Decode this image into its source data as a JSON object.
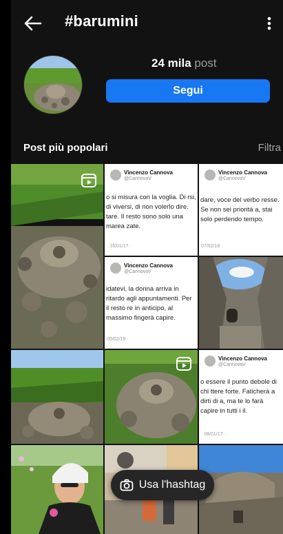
{
  "header": {
    "title": "#barumini"
  },
  "profile": {
    "post_count": "24 mila",
    "post_label": "post",
    "follow_label": "Segui"
  },
  "section": {
    "title": "Post più popolari",
    "filter_label": "Filtra"
  },
  "tweets": [
    {
      "name": "Vincenzo Cannova",
      "handle": "@CannovaV",
      "text": "o si misura con la voglia. Di rsi, di viversi, di non volerlo dire. tare. Il resto sono solo una marea zate.",
      "date": "· 16/01/17 ·"
    },
    {
      "name": "Vincenzo Cannova",
      "handle": "@CannovaV",
      "text": "dare, voce del verbo resse. Se non sei priorità a, stai solo perdendo tempo.",
      "date": "07/02/18 ·"
    },
    {
      "name": "Vincenzo Cannova",
      "handle": "@CannovaV",
      "text": "idatevi, la donna arriva in ritardo agli appuntamenti. Per il resto re in anticipo, al massimo fingerà capire.",
      "date": "05/02/19 ·"
    },
    {
      "name": "Vincenzo Cannova",
      "handle": "@CannovaV",
      "text": "o essere il punto debole di chi ttere forte. Faticherà a dirti di a, ma te lo farà capire in tutti i il.",
      "date": "· 08/01/17 ·"
    }
  ],
  "fab": {
    "label": "Usa l'hashtag"
  },
  "colors": {
    "accent": "#1877f2",
    "background": "#121212"
  }
}
